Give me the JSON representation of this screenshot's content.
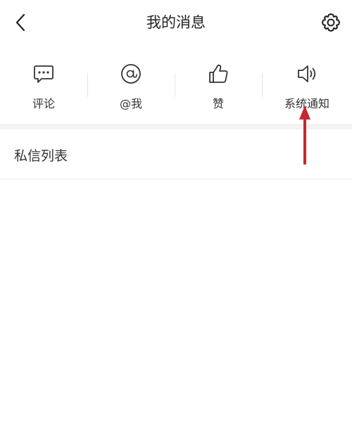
{
  "header": {
    "title": "我的消息",
    "back_icon": "chevron-left-icon",
    "settings_icon": "gear-icon"
  },
  "categories": [
    {
      "label": "评论",
      "icon": "comment-bubble-icon"
    },
    {
      "label": "@我",
      "icon": "at-sign-icon"
    },
    {
      "label": "赞",
      "icon": "thumbs-up-icon"
    },
    {
      "label": "系统通知",
      "icon": "speaker-icon"
    }
  ],
  "section": {
    "dm_list_label": "私信列表"
  },
  "colors": {
    "annotation_arrow": "#c62832",
    "divider": "#eaeaea",
    "gap": "#f3f3f3"
  }
}
